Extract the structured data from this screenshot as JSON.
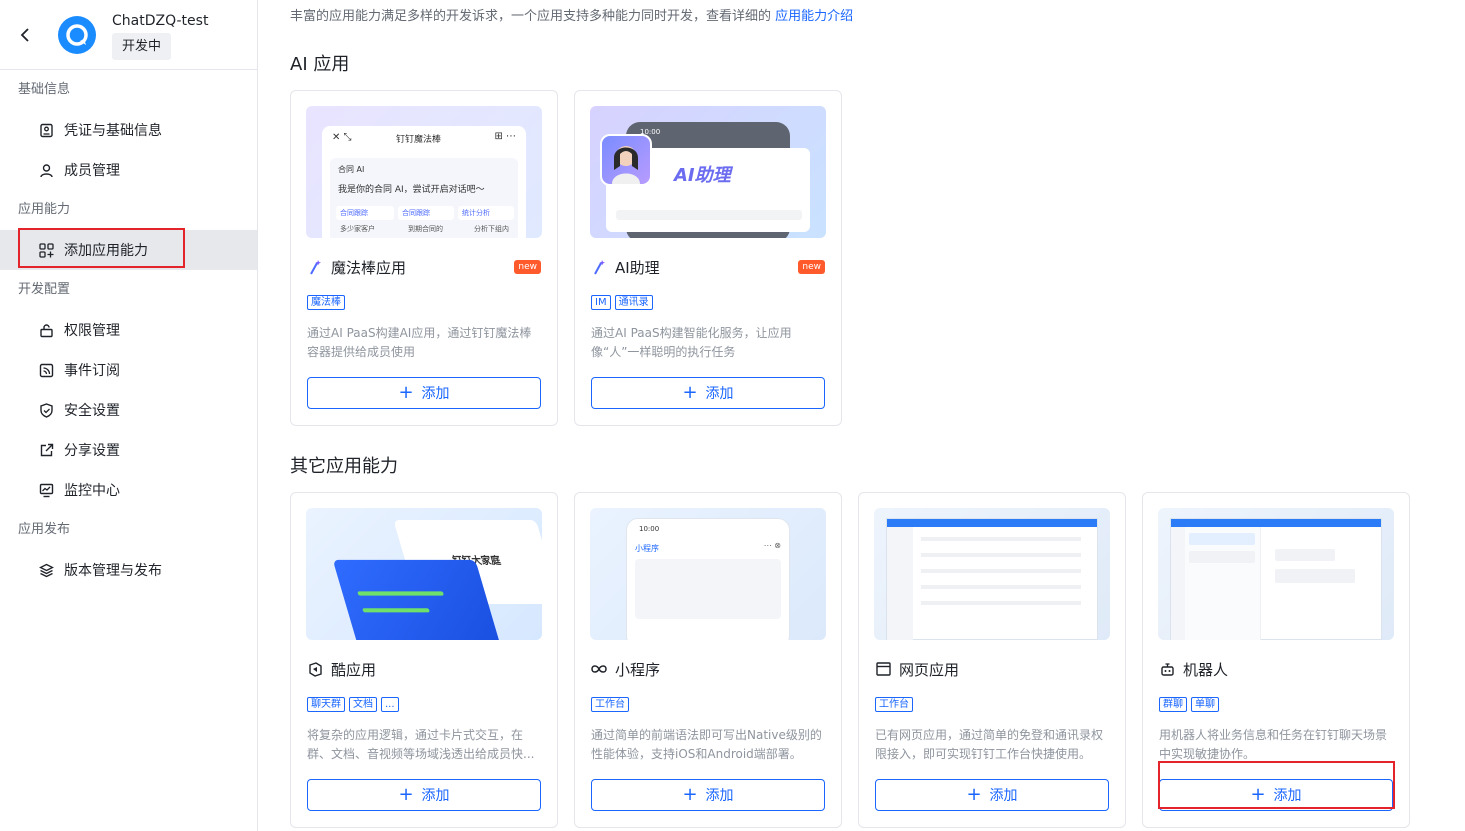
{
  "app": {
    "name": "ChatDZQ-test",
    "status": "开发中"
  },
  "sidebar": {
    "groups": [
      {
        "title": "基础信息",
        "items": [
          {
            "label": "凭证与基础信息",
            "icon": "credential-icon"
          },
          {
            "label": "成员管理",
            "icon": "user-icon"
          }
        ]
      },
      {
        "title": "应用能力",
        "items": [
          {
            "label": "添加应用能力",
            "icon": "apps-add-icon",
            "active": true
          }
        ]
      },
      {
        "title": "开发配置",
        "items": [
          {
            "label": "权限管理",
            "icon": "lock-icon"
          },
          {
            "label": "事件订阅",
            "icon": "rss-icon"
          },
          {
            "label": "安全设置",
            "icon": "shield-icon"
          },
          {
            "label": "分享设置",
            "icon": "share-icon"
          },
          {
            "label": "监控中心",
            "icon": "monitor-icon"
          }
        ]
      },
      {
        "title": "应用发布",
        "items": [
          {
            "label": "版本管理与发布",
            "icon": "layers-icon"
          }
        ]
      }
    ]
  },
  "main": {
    "intro_text": "丰富的应用能力满足多样的开发诉求，一个应用支持多种能力同时开发，查看详细的",
    "intro_link": "应用能力介绍",
    "ai_section_title": "AI 应用",
    "other_section_title": "其它应用能力",
    "add_label": "添加",
    "ai_cards": [
      {
        "title": "魔法棒应用",
        "badge": "new",
        "tags": [
          "魔法棒"
        ],
        "desc": "通过AI PaaS构建AI应用，通过钉钉魔法棒容器提供给成员使用",
        "thumb": {
          "header": "钉钉魔法棒",
          "sub": "合同 AI",
          "greeting": "我是你的合同 AI，尝试开启对话吧～",
          "chips": [
            "合同跟踪",
            "合同跟踪",
            "统计分析"
          ],
          "chips2": [
            "多少家客户",
            "到期合同的",
            "分析下组内"
          ]
        }
      },
      {
        "title": "AI助理",
        "badge": "new",
        "tags": [
          "IM",
          "通讯录"
        ],
        "desc": "通过AI PaaS构建智能化服务，让应用像“人”一样聪明的执行任务",
        "thumb": {
          "time": "10:00",
          "label": "AI助理"
        }
      }
    ],
    "other_cards": [
      {
        "title": "酷应用",
        "tags": [
          "聊天群",
          "文档",
          "..."
        ],
        "desc": "将复杂的应用逻辑，通过卡片式交互，在群、文档、音视频等场域浅透出给成员快...",
        "thumb": {
          "text": "钉钉大家庭"
        }
      },
      {
        "title": "小程序",
        "tags": [
          "工作台"
        ],
        "desc": "通过简单的前端语法即可写出Native级别的性能体验，支持iOS和Android端部署。",
        "thumb": {
          "time": "10:00",
          "label": "小程序"
        }
      },
      {
        "title": "网页应用",
        "tags": [
          "工作台"
        ],
        "desc": "已有网页应用，通过简单的免登和通讯录权限接入，即可实现钉钉工作台快捷使用。"
      },
      {
        "title": "机器人",
        "tags": [
          "群聊",
          "单聊"
        ],
        "desc": "用机器人将业务信息和任务在钉钉聊天场景中实现敏捷协作。"
      }
    ]
  },
  "colors": {
    "accent": "#1a66ff",
    "highlight": "#e3242b",
    "badge": "#ff5a2c"
  }
}
